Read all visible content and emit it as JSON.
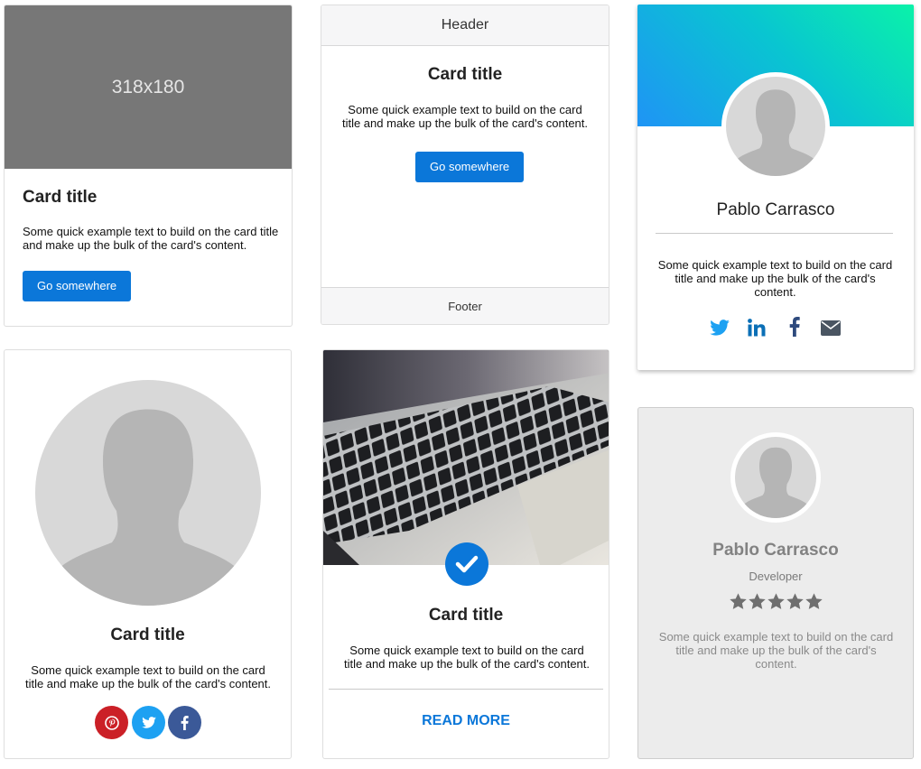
{
  "card1": {
    "image_label": "318x180",
    "title": "Card title",
    "text": "Some quick example text to build on the card title and make up the bulk of the card's content.",
    "button": "Go somewhere"
  },
  "card2": {
    "header": "Header",
    "title": "Card title",
    "text": "Some quick example text to build on the card title and make up the bulk of the card's content.",
    "button": "Go somewhere",
    "footer": "Footer"
  },
  "card3": {
    "name": "Pablo Carrasco",
    "text": "Some quick example text to build on the card title and make up the bulk of the card's content.",
    "icons": [
      "twitter-icon",
      "linkedin-icon",
      "facebook-icon",
      "envelope-icon"
    ],
    "gradient": [
      "#1f94f5",
      "#0af2a9"
    ]
  },
  "card4": {
    "title": "Card title",
    "text": "Some quick example text to build on the card title and make up the bulk of the card's content.",
    "social": [
      {
        "icon": "pinterest-icon",
        "color": "#cb2027"
      },
      {
        "icon": "twitter-icon",
        "color": "#1da1f2"
      },
      {
        "icon": "facebook-icon",
        "color": "#3b5998"
      }
    ]
  },
  "card5": {
    "title": "Card title",
    "text": "Some quick example text to build on the card title and make up the bulk of the card's content.",
    "link": "READ MORE"
  },
  "card6": {
    "name": "Pablo Carrasco",
    "role": "Developer",
    "rating": 5,
    "rating_max": 5,
    "text": "Some quick example text to build on the card title and make up the bulk of the card's content."
  },
  "colors": {
    "primary": "#0b77d9",
    "placeholder_bg": "#777777"
  }
}
